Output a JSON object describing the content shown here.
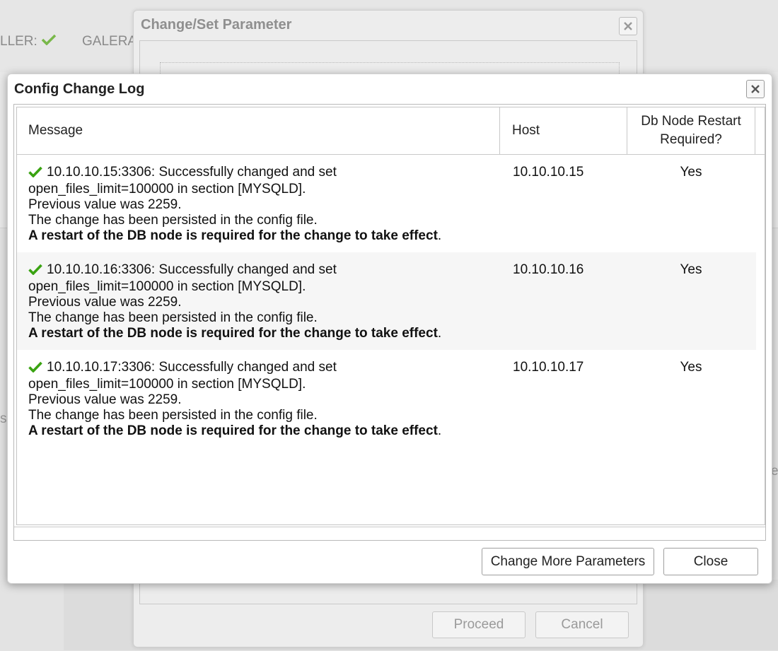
{
  "background": {
    "status_label_1": "LLER:",
    "status_label_2": "GALERA",
    "status_icon": "check-icon",
    "edge_glyph_left": "s",
    "edge_glyph_right": "e"
  },
  "back_dialog": {
    "title": "Change/Set Parameter",
    "proceed_label": "Proceed",
    "cancel_label": "Cancel"
  },
  "dialog": {
    "title": "Config Change Log",
    "columns": [
      "Message",
      "Host",
      "Db Node Restart Required?"
    ],
    "rows": [
      {
        "status_icon": "check-icon",
        "line1": "10.10.10.15:3306: Successfully changed and set",
        "line2": "open_files_limit=100000 in section [MYSQLD].",
        "line3": "Previous value was 2259.",
        "line4": "The change has been persisted in the config file.",
        "line5_bold": "A restart of the DB node is required for the change to take effect",
        "line5_end": ".",
        "host": "10.10.10.15",
        "restart": "Yes"
      },
      {
        "status_icon": "check-icon",
        "line1": "10.10.10.16:3306: Successfully changed and set",
        "line2": "open_files_limit=100000 in section [MYSQLD].",
        "line3": "Previous value was 2259.",
        "line4": "The change has been persisted in the config file.",
        "line5_bold": "A restart of the DB node is required for the change to take effect",
        "line5_end": ".",
        "host": "10.10.10.16",
        "restart": "Yes"
      },
      {
        "status_icon": "check-icon",
        "line1": "10.10.10.17:3306: Successfully changed and set",
        "line2": "open_files_limit=100000 in section [MYSQLD].",
        "line3": "Previous value was 2259.",
        "line4": "The change has been persisted in the config file.",
        "line5_bold": "A restart of the DB node is required for the change to take effect",
        "line5_end": ".",
        "host": "10.10.10.17",
        "restart": "Yes"
      }
    ],
    "buttons": {
      "change_more": "Change More Parameters",
      "close": "Close"
    }
  },
  "colors": {
    "check_green": "#3aa312",
    "alt_row": "#f6f6f6",
    "dialog_bg": "#ffffff"
  }
}
